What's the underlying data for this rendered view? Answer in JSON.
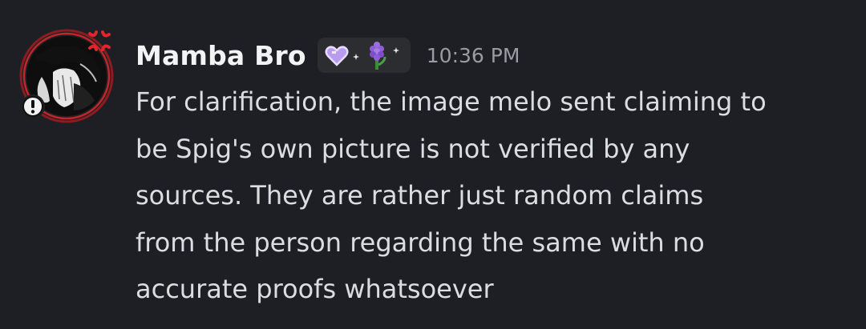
{
  "message": {
    "author": "Mamba Bro",
    "timestamp": "10:36 PM",
    "text_lines": [
      "For clarification, the image melo sent claiming to",
      "be Spig's own picture is not verified by any",
      "sources. They are rather just random claims",
      "from the person regarding the same with no",
      "accurate proofs whatsoever"
    ],
    "avatar": {
      "decoration_icon": "anger-symbol-icon",
      "status_icon": "exclamation-badge-icon"
    },
    "guild_tag": {
      "icons": [
        "purple-heart-icon",
        "sparkle-icon",
        "hyacinth-icon",
        "sparkle-icon"
      ]
    }
  },
  "colors": {
    "background": "#1e1f24",
    "username": "#f2f3f5",
    "text": "#dbdee1",
    "timestamp": "#9a9ca4",
    "tag_background": "#2b2d31",
    "avatar_ring": "#c0262a",
    "heart": "#b89cf2",
    "hyacinth": "#8d5ed6"
  }
}
